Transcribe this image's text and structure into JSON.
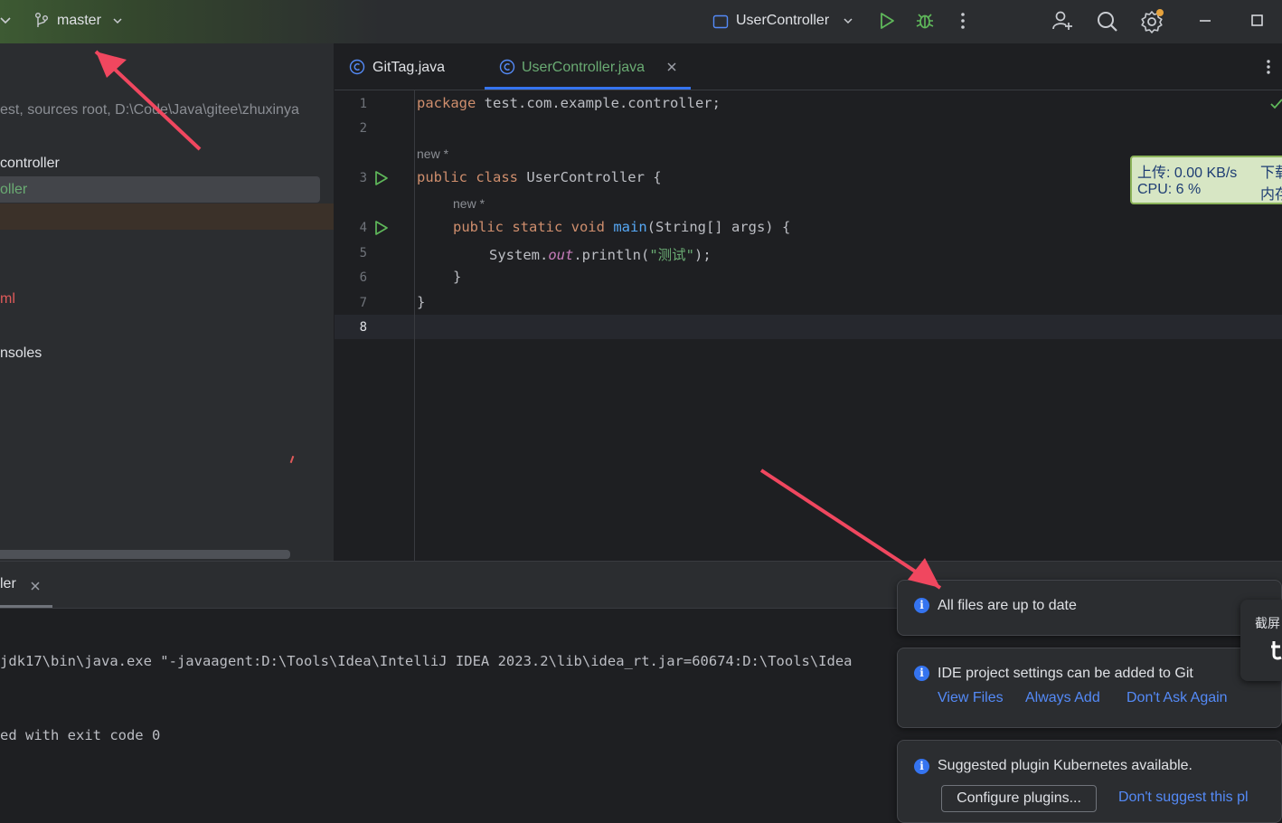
{
  "titlebar": {
    "branch": "master",
    "run_config": "UserController"
  },
  "project": {
    "root_hint": "est,  sources root,  D:\\Code\\Java\\gitee\\zhuxinya",
    "items": [
      {
        "label": "controller"
      },
      {
        "label": "oller"
      },
      {
        "label": "ml"
      },
      {
        "label": "nsoles"
      }
    ]
  },
  "editor": {
    "tabs": [
      {
        "label": "GitTag.java"
      },
      {
        "label": "UserController.java"
      }
    ],
    "hint_new": "new *",
    "code": {
      "l1_kw": "package",
      "l1_rest": " test.com.example.controller;",
      "l3_kw": "public class",
      "l3_rest": " UserController {",
      "l4_kw": "public static void",
      "l4_fn": "main",
      "l4_rest": "(String[] args) {",
      "l5_a": "System.",
      "l5_out": "out",
      "l5_b": ".println(",
      "l5_str": "\"测试\"",
      "l5_c": ");",
      "l6": "}",
      "l7": "}"
    },
    "line_numbers": [
      "1",
      "2",
      "3",
      "4",
      "5",
      "6",
      "7",
      "8"
    ]
  },
  "netmon": {
    "upload": "上传: 0.00 KB/s",
    "download": "下载",
    "cpu": "CPU: 6 %",
    "mem": "内存"
  },
  "bottom": {
    "tab_label": "ler",
    "console_line1": "jdk17\\bin\\java.exe \"-javaagent:D:\\Tools\\Idea\\IntelliJ IDEA 2023.2\\lib\\idea_rt.jar=60674:D:\\Tools\\Idea",
    "console_line2": "ed with exit code 0"
  },
  "notifications": {
    "n1": "All files are up to date",
    "n2": "IDE project settings can be added to Git",
    "n2_links": [
      "View Files",
      "Always Add",
      "Don't Ask Again"
    ],
    "n3": "Suggested plugin Kubernetes available.",
    "n3_button": "Configure plugins...",
    "n3_link": "Don't suggest this pl",
    "side_label": "截屏"
  },
  "colors": {
    "accent": "#3574f0",
    "arrow": "#f0475f",
    "run_green": "#5fb85a"
  }
}
